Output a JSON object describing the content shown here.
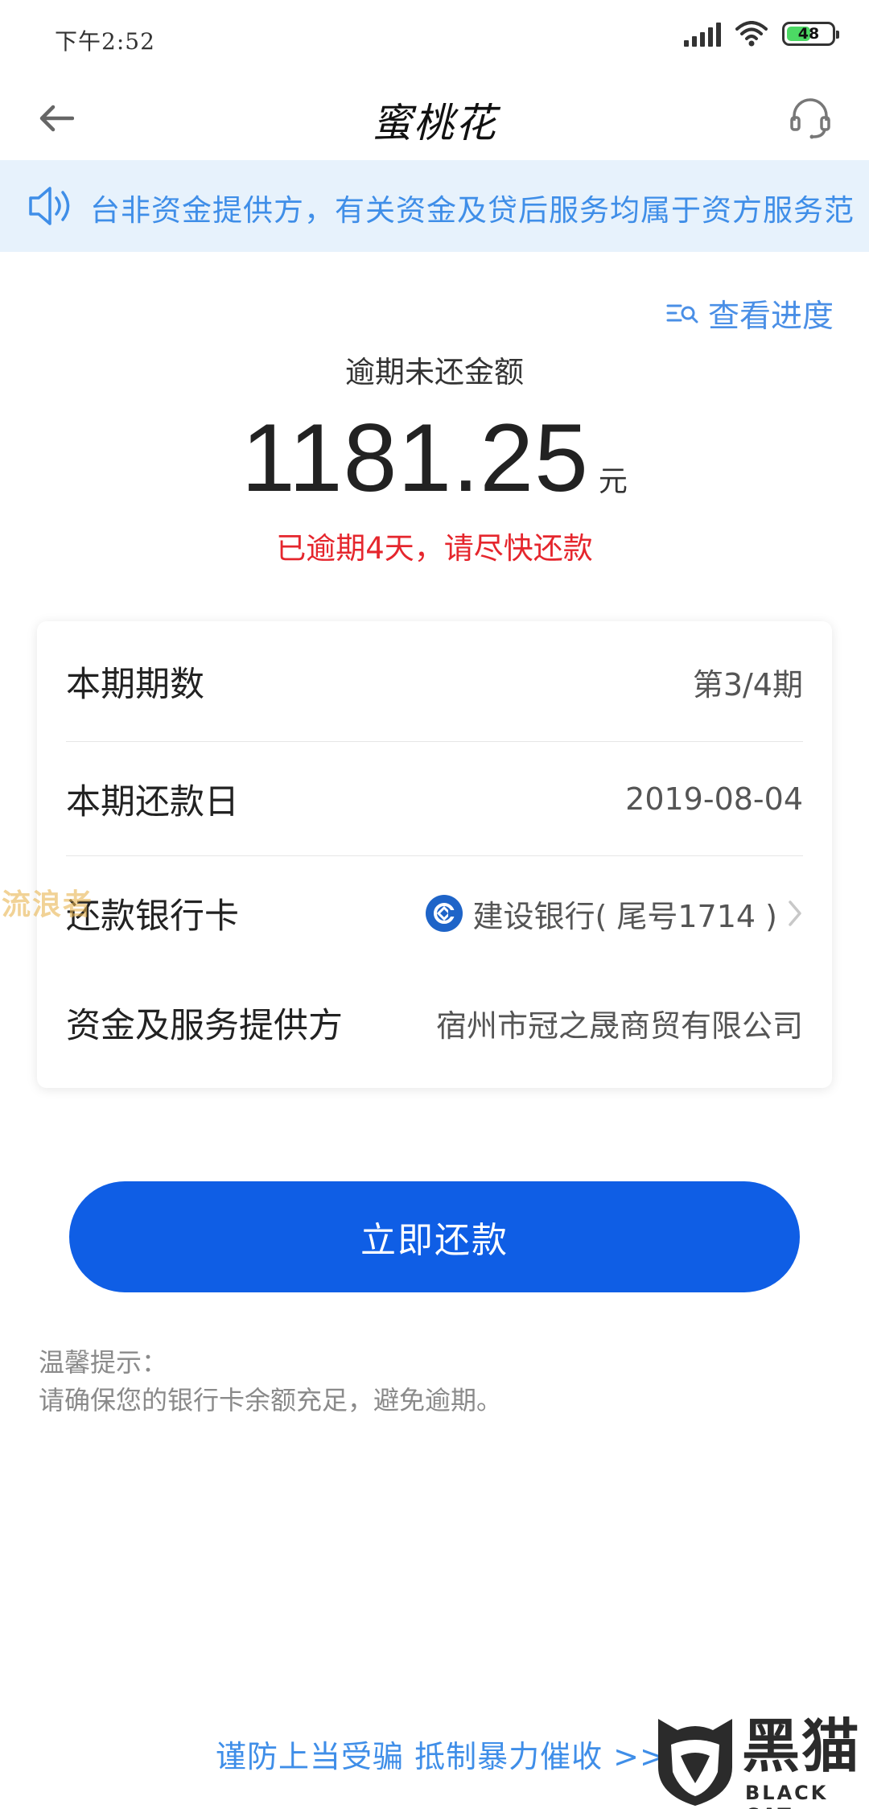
{
  "status_bar": {
    "time": "下午2:52",
    "battery_level": "48"
  },
  "nav": {
    "title": "蜜桃花"
  },
  "notice": {
    "text": "台非资金提供方，有关资金及贷后服务均属于资方服务范"
  },
  "progress_link": {
    "label": "查看进度"
  },
  "amount": {
    "label": "逾期未还金额",
    "value": "1181.25",
    "unit": "元",
    "overdue_message": "已逾期4天，请尽快还款"
  },
  "info": {
    "rows": [
      {
        "label": "本期期数",
        "value": "第3/4期"
      },
      {
        "label": "本期还款日",
        "value": "2019-08-04"
      },
      {
        "label": "还款银行卡",
        "value": "建设银行( 尾号1714 )"
      },
      {
        "label": "资金及服务提供方",
        "value": "宿州市冠之晟商贸有限公司"
      }
    ]
  },
  "watermark": {
    "text": "流浪者"
  },
  "repay_button": {
    "label": "立即还款"
  },
  "tips": {
    "title": "温馨提示：",
    "body": "请确保您的银行卡余额充足，避免逾期。"
  },
  "footer": {
    "fraud_link": "谨防上当受骗 抵制暴力催收 >>"
  },
  "logo": {
    "cn": "黑猫",
    "en": "BLACK CAT"
  },
  "colors": {
    "primary_blue": "#0f5ee5",
    "link_blue": "#3f8ee8",
    "notice_bg": "#e7f2fc",
    "overdue_red": "#e5262d",
    "battery_green": "#4cd964"
  },
  "icons": [
    "back-arrow-icon",
    "headset-icon",
    "speaker-icon",
    "search-list-icon",
    "bank-logo-icon",
    "chevron-right-icon",
    "signal-icon",
    "wifi-icon"
  ]
}
